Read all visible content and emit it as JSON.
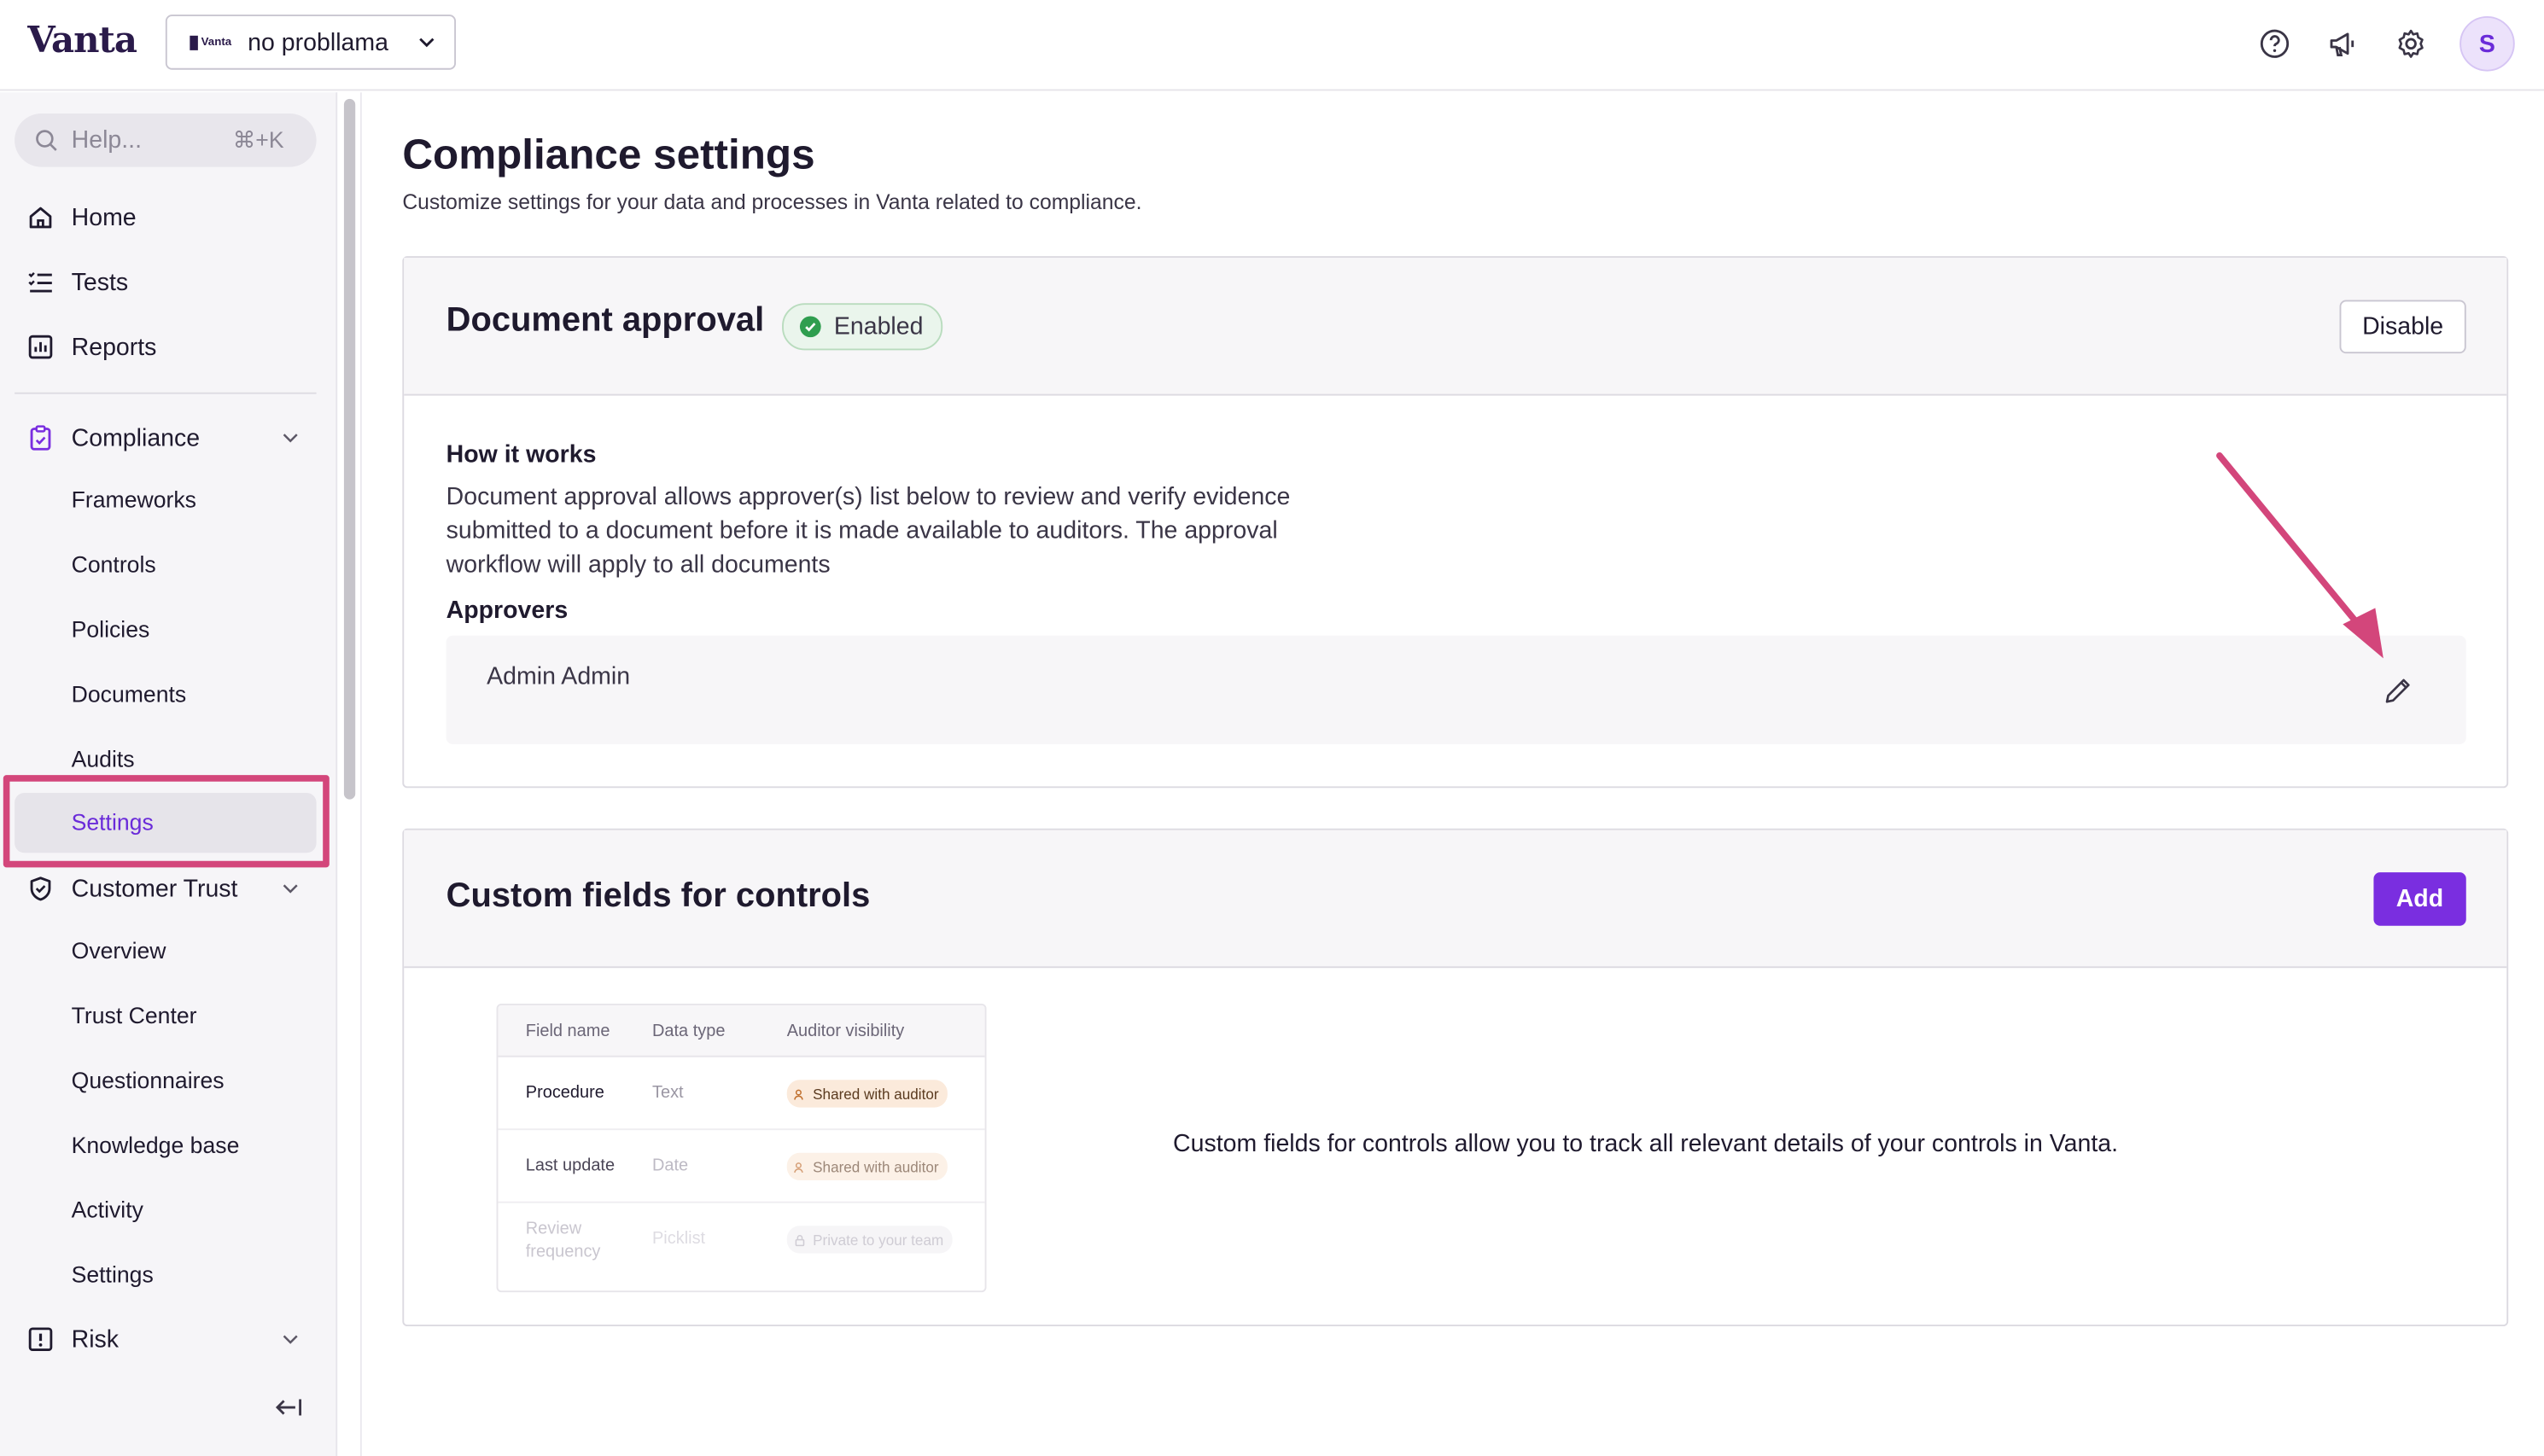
{
  "topbar": {
    "logo": "Vanta",
    "workspace_logo": "Vanta",
    "workspace_name": "no probllama",
    "icons": [
      "help-circle-icon",
      "megaphone-icon",
      "gear-icon"
    ],
    "avatar_initial": "S"
  },
  "sidebar": {
    "search_placeholder": "Help...",
    "search_shortcut": "⌘+K",
    "primary": [
      {
        "label": "Home",
        "icon": "home-icon"
      },
      {
        "label": "Tests",
        "icon": "list-check-icon"
      },
      {
        "label": "Reports",
        "icon": "bar-chart-icon"
      }
    ],
    "compliance": {
      "label": "Compliance",
      "icon": "clipboard-icon",
      "items": [
        "Frameworks",
        "Controls",
        "Policies",
        "Documents",
        "Audits",
        "Settings"
      ],
      "active": "Settings"
    },
    "customer_trust": {
      "label": "Customer Trust",
      "icon": "shield-check-icon",
      "items": [
        "Overview",
        "Trust Center",
        "Questionnaires",
        "Knowledge base",
        "Activity",
        "Settings"
      ]
    },
    "risk": {
      "label": "Risk",
      "icon": "alert-square-icon"
    }
  },
  "main": {
    "title": "Compliance settings",
    "subtitle": "Customize settings for your data and processes in Vanta related to compliance.",
    "document_approval": {
      "title": "Document approval",
      "status": "Enabled",
      "button": "Disable",
      "how_title": "How it works",
      "how_text": "Document approval allows approver(s) list below to review and verify evidence submitted to a document before it is made available to auditors. The approval workflow will apply to all documents",
      "approvers_title": "Approvers",
      "approvers": [
        "Admin Admin"
      ]
    },
    "custom_fields": {
      "title": "Custom fields for controls",
      "button": "Add",
      "description": "Custom fields for controls allow you to track all relevant details of your controls in Vanta.",
      "preview": {
        "headers": [
          "Field name",
          "Data type",
          "Auditor visibility"
        ],
        "rows": [
          {
            "name": "Procedure",
            "type": "Text",
            "visibility": "Shared with auditor"
          },
          {
            "name": "Last update",
            "type": "Date",
            "visibility": "Shared with auditor"
          },
          {
            "name": "Review frequency",
            "type": "Picklist",
            "visibility": "Private to your team"
          }
        ]
      }
    }
  },
  "colors": {
    "accent": "#7a2ee0",
    "highlight": "#d3467b",
    "success": "#2f9e4f"
  }
}
